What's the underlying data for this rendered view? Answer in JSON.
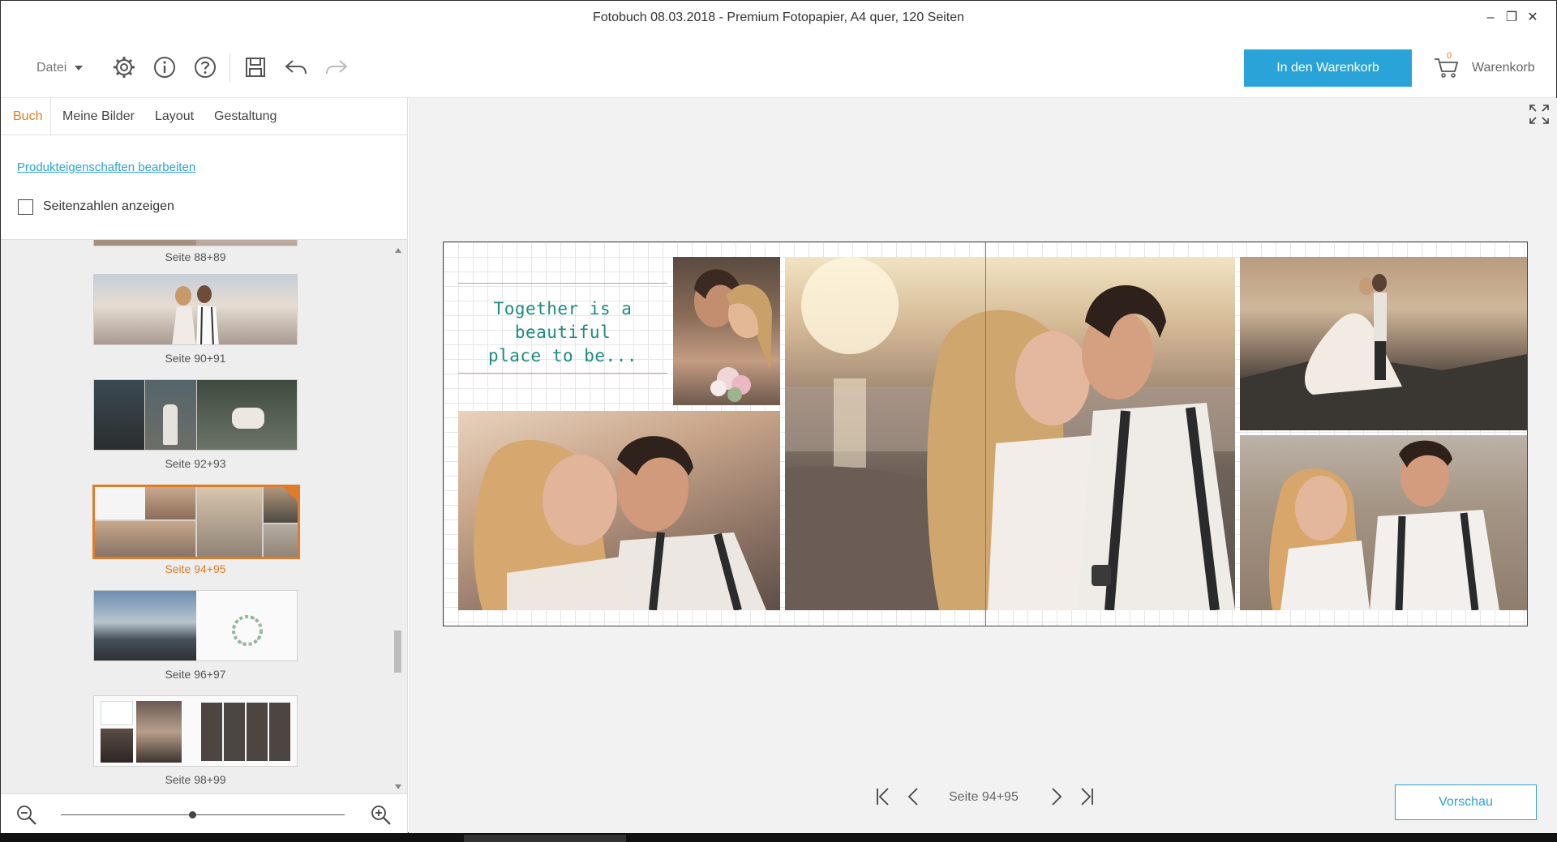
{
  "window": {
    "title": "Fotobuch 08.03.2018 - Premium Fotopapier, A4 quer, 120 Seiten",
    "minimize": "–",
    "restore": "❐",
    "close": "✕"
  },
  "toolbar": {
    "file_menu": "Datei",
    "icons": [
      "gear-icon",
      "info-icon",
      "help-icon",
      "save-icon",
      "undo-icon",
      "redo-icon"
    ],
    "add_to_cart": "In den Warenkorb",
    "cart_count": "0",
    "cart_label": "Warenkorb"
  },
  "left_panel": {
    "tabs": [
      {
        "label": "Buch",
        "active": true
      },
      {
        "label": "Meine Bilder",
        "active": false
      },
      {
        "label": "Layout",
        "active": false
      },
      {
        "label": "Gestaltung",
        "active": false
      }
    ],
    "product_link": "Produkteigenschaften bearbeiten",
    "show_page_numbers": {
      "label": "Seitenzahlen anzeigen",
      "checked": false
    },
    "thumbnails": [
      {
        "label": "Seite 88+89",
        "active": false
      },
      {
        "label": "Seite 90+91",
        "active": false
      },
      {
        "label": "Seite 92+93",
        "active": false
      },
      {
        "label": "Seite 94+95",
        "active": true
      },
      {
        "label": "Seite 96+97",
        "active": false
      },
      {
        "label": "Seite 98+99",
        "active": false
      }
    ]
  },
  "canvas": {
    "quote": [
      "Together is a",
      "beautiful",
      "place to be..."
    ],
    "current_page": "Seite 94+95",
    "preview_button": "Vorschau"
  },
  "colors": {
    "accent_orange": "#e07b2a",
    "accent_blue": "#2aa3d8",
    "quote_teal": "#1f8a7e"
  }
}
